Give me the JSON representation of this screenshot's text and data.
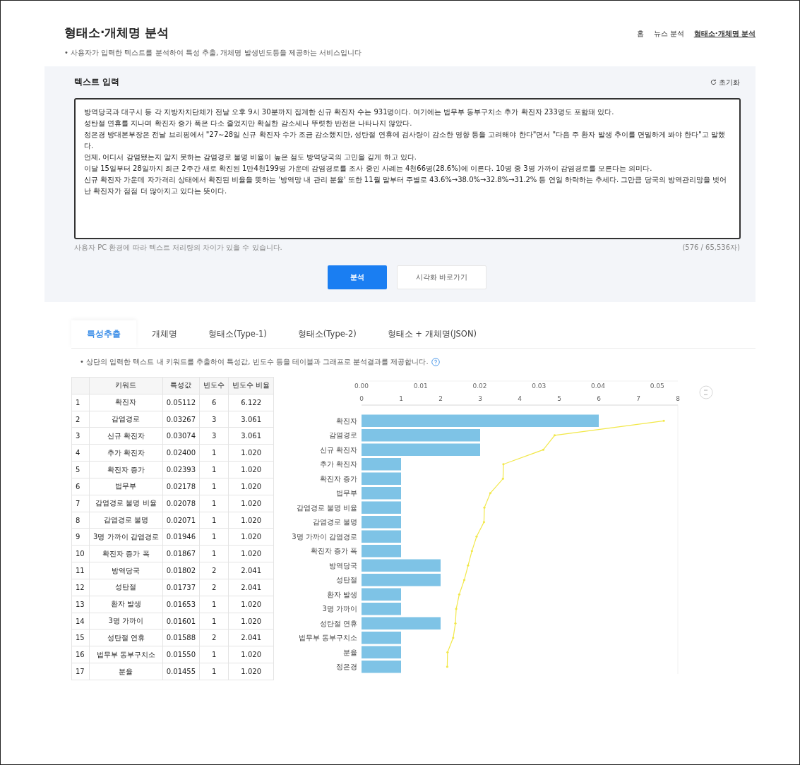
{
  "header": {
    "title": "형태소·개체명 분석",
    "description": "• 사용자가 입력한 텍스트를 분석하여 특성 추출, 개체명 발생빈도등을 제공하는 서비스입니다",
    "breadcrumb": [
      {
        "label": "홈",
        "selected": false
      },
      {
        "label": "뉴스 분석",
        "selected": false
      },
      {
        "label": "형태소·개체명 분석",
        "selected": true
      }
    ]
  },
  "input_panel": {
    "title": "텍스트 입력",
    "reset": "초기화",
    "text_lines": [
      "방역당국과 대구시 등 각 지방자치단체가 전날 오후 9시 30분까지 집계한 신규 확진자 수는 931명이다. 여기에는 법무부 동부구치소 추가 확진자 233명도 포함돼 있다.",
      "성탄절 연휴를 지나며 확진자 증가 폭은 다소 줄었지만 확실한 감소세나 뚜렷한 반전은 나타나지 않았다.",
      "정은경 방대본부장은 전날 브리핑에서 \"27∼28일 신규 확진자 수가 조금 감소했지만, 성탄절 연휴에 검사량이 감소한 영향 등을 고려해야 한다\"면서 \"다음 주 환자 발생 추이를 면밀하게 봐야 한다\"고 말했다.",
      "언제, 어디서 감염됐는지 알지 못하는 감염경로 불명 비율이 높은 점도 방역당국의 고민을 깊게 하고 있다.",
      "이달 15일부터 28일까지 최근 2주간 새로 확진된 1만4천199명 가운데 감염경로를 조사 중인 사례는 4천66명(28.6%)에 이른다. 10명 중 3명 가까이 감염경로를 모른다는 의미다.",
      "신규 확진자 가운데 자가격리 상태에서 확진된 비율을 뜻하는 '방역망 내 관리 분율' 또한 11월 말부터 주별로 43.6%→38.0%→32.8%→31.2% 등 연일 하락하는 추세다. 그만큼 당국의 방역관리망을 벗어난 확진자가 점점 더 많아지고 있다는 뜻이다."
    ],
    "notice": "사용자 PC 환경에 따라 텍스트 처리량의 차이가 있을 수 있습니다.",
    "counter": "(576 / 65,536자)",
    "buttons": [
      {
        "label": "분석",
        "kind": "primary"
      },
      {
        "label": "시각화 바로가기",
        "kind": "secondary"
      }
    ]
  },
  "tabs": [
    {
      "label": "특성추출",
      "selected": true
    },
    {
      "label": "개체명",
      "selected": false
    },
    {
      "label": "형태소(Type-1)",
      "selected": false
    },
    {
      "label": "형태소(Type-2)",
      "selected": false
    },
    {
      "label": "형태소 + 개체명(JSON)",
      "selected": false
    }
  ],
  "tab_description": "• 상단의 입력한 텍스트 내 키워드를 추출하여 특성값, 빈도수 등을 테이블과 그래프로 분석결과를 제공합니다.",
  "table": {
    "columns": [
      "키워드",
      "특성값",
      "빈도수",
      "빈도수 비율"
    ],
    "rows": [
      {
        "no": "1",
        "cells": [
          "확진자",
          "0.05112",
          "6",
          "6.122"
        ]
      },
      {
        "no": "2",
        "cells": [
          "감염경로",
          "0.03267",
          "3",
          "3.061"
        ]
      },
      {
        "no": "3",
        "cells": [
          "신규 확진자",
          "0.03074",
          "3",
          "3.061"
        ]
      },
      {
        "no": "4",
        "cells": [
          "추가 확진자",
          "0.02400",
          "1",
          "1.020"
        ]
      },
      {
        "no": "5",
        "cells": [
          "확진자 증가",
          "0.02393",
          "1",
          "1.020"
        ]
      },
      {
        "no": "6",
        "cells": [
          "법무부",
          "0.02178",
          "1",
          "1.020"
        ]
      },
      {
        "no": "7",
        "cells": [
          "감염경로 불명 비율",
          "0.02078",
          "1",
          "1.020"
        ]
      },
      {
        "no": "8",
        "cells": [
          "감염경로 불명",
          "0.02071",
          "1",
          "1.020"
        ]
      },
      {
        "no": "9",
        "cells": [
          "3명 가까이 감염경로",
          "0.01946",
          "1",
          "1.020"
        ]
      },
      {
        "no": "10",
        "cells": [
          "확진자 증가 폭",
          "0.01867",
          "1",
          "1.020"
        ]
      },
      {
        "no": "11",
        "cells": [
          "방역당국",
          "0.01802",
          "2",
          "2.041"
        ]
      },
      {
        "no": "12",
        "cells": [
          "성탄절",
          "0.01737",
          "2",
          "2.041"
        ]
      },
      {
        "no": "13",
        "cells": [
          "환자 발생",
          "0.01653",
          "1",
          "1.020"
        ]
      },
      {
        "no": "14",
        "cells": [
          "3명 가까이",
          "0.01601",
          "1",
          "1.020"
        ]
      },
      {
        "no": "15",
        "cells": [
          "성탄절 연휴",
          "0.01588",
          "2",
          "2.041"
        ]
      },
      {
        "no": "16",
        "cells": [
          "법무부 동부구치소",
          "0.01550",
          "1",
          "1.020"
        ]
      },
      {
        "no": "17",
        "cells": [
          "분율",
          "0.01455",
          "1",
          "1.020"
        ]
      }
    ]
  },
  "chart_data": {
    "type": "bar",
    "orientation": "horizontal",
    "categories": [
      "확진자",
      "감염경로",
      "신규 확진자",
      "추가 확진자",
      "확진자 증가",
      "법무부",
      "감염경로 불명 비율",
      "감염경로 불명",
      "3명 가까이 감염경로",
      "확진자 증가 폭",
      "방역당국",
      "성탄절",
      "환자 발생",
      "3명 가까이",
      "성탄절 연휴",
      "법무부 동부구치소",
      "분율",
      "정은경"
    ],
    "series": [
      {
        "color": "#7ec3e6",
        "values": [
          6,
          3,
          3,
          1,
          1,
          1,
          1,
          1,
          1,
          1,
          2,
          2,
          1,
          1,
          2,
          1,
          1,
          1
        ]
      },
      {
        "type": "line",
        "axis": "x2",
        "color": "#f2e84a",
        "values": [
          0.05112,
          0.03267,
          0.03074,
          0.024,
          0.02393,
          0.02178,
          0.02078,
          0.02071,
          0.01946,
          0.01867,
          0.01802,
          0.01737,
          0.01653,
          0.01601,
          0.01588,
          0.0155,
          0.01455,
          0.0145
        ]
      }
    ],
    "xlim": [
      0,
      8
    ],
    "x2lim": [
      0,
      0.0535
    ],
    "xticks": [
      0,
      1,
      2,
      3,
      4,
      5,
      6,
      7,
      8
    ],
    "x2ticks": [
      {
        "value": 0,
        "label": "0.00"
      },
      {
        "value": 0.01,
        "label": "0.01"
      },
      {
        "value": 0.02,
        "label": "0.02"
      },
      {
        "value": 0.03,
        "label": "0.03"
      },
      {
        "value": 0.04,
        "label": "0.04"
      },
      {
        "value": 0.05,
        "label": "0.05"
      }
    ]
  }
}
